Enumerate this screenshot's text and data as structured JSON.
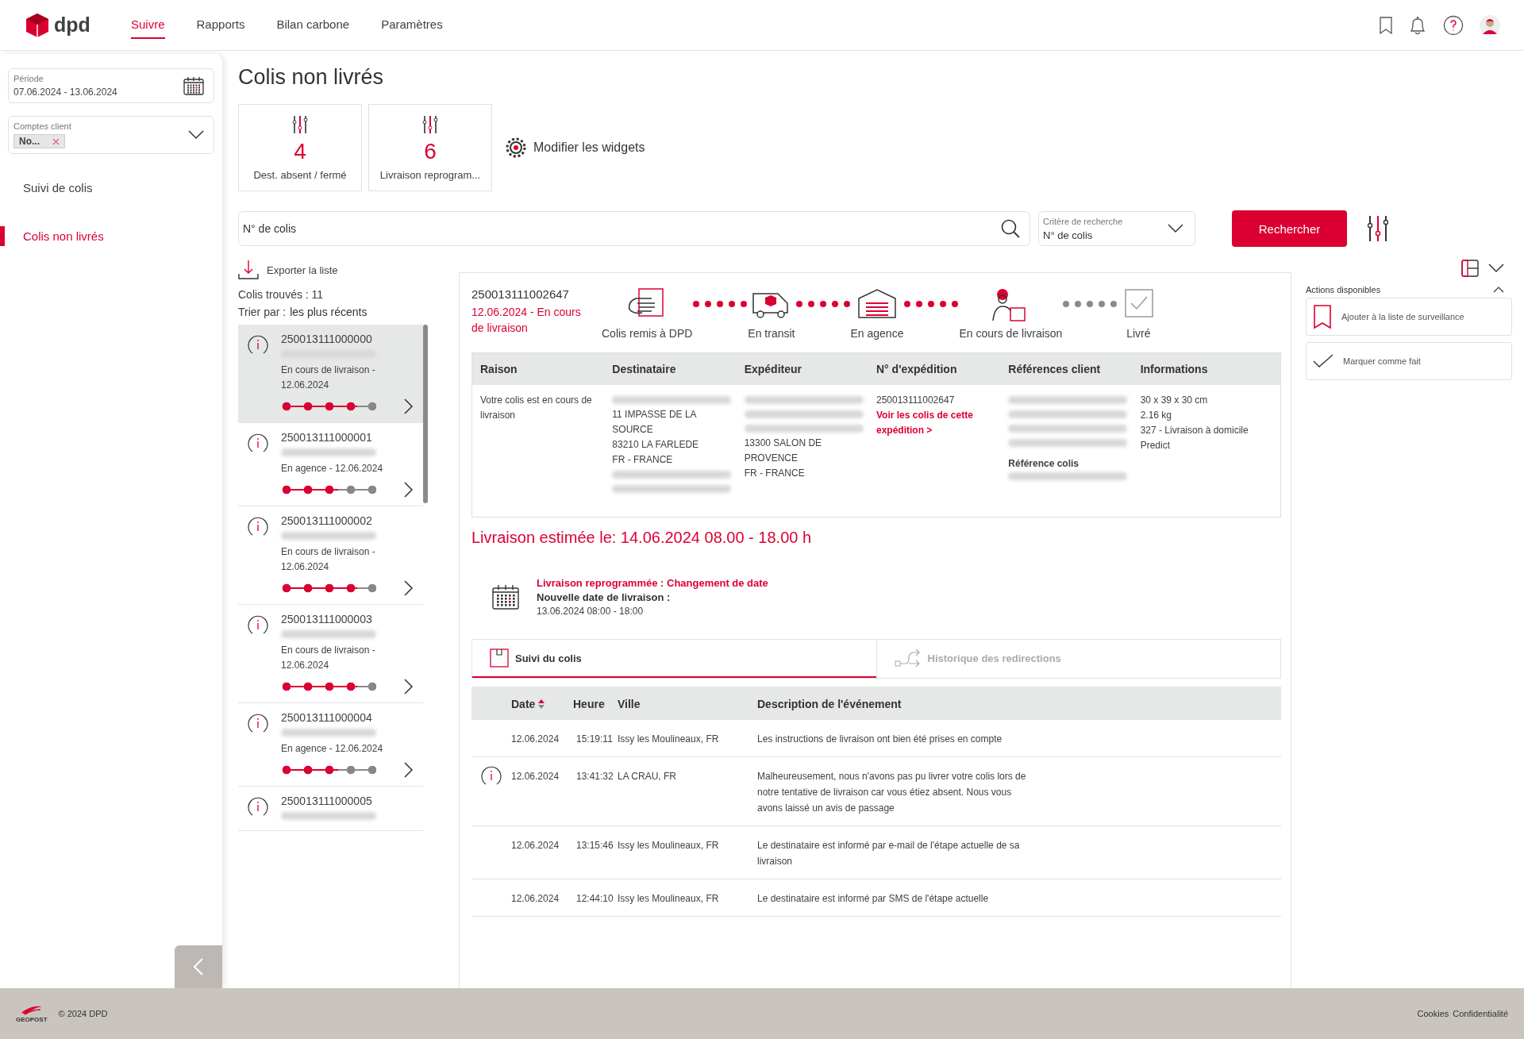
{
  "header": {
    "logo_text": "dpd",
    "nav": [
      {
        "label": "Suivre",
        "selected": true
      },
      {
        "label": "Rapports",
        "selected": false
      },
      {
        "label": "Bilan carbone",
        "selected": false
      },
      {
        "label": "Paramètres",
        "selected": false
      }
    ]
  },
  "sidebar": {
    "period": {
      "label": "Période",
      "value": "07.06.2024 - 13.06.2024"
    },
    "accounts": {
      "label": "Comptes client",
      "chip": "No..."
    },
    "items": [
      {
        "label": "Suivi de colis",
        "selected": false
      },
      {
        "label": "Colis non livrés",
        "selected": true
      }
    ]
  },
  "page_title": "Colis non livrés",
  "widgets": [
    {
      "count": "4",
      "label": "Dest. absent / fermé"
    },
    {
      "count": "6",
      "label": "Livraison reprogram..."
    }
  ],
  "modify_widgets": "Modifier les widgets",
  "search": {
    "placeholder": "N° de colis",
    "criterion_label": "Critère de recherche",
    "criterion_value": "N° de colis",
    "button": "Rechercher"
  },
  "export": "Exporter la liste",
  "found": "Colis trouvés : 11",
  "sort": {
    "label": "Trier par :",
    "value": "les plus récents"
  },
  "parcels": [
    {
      "number": "250013111000000",
      "status": "En cours de livraison - 12.06.2024",
      "level": 0.8,
      "selected": true
    },
    {
      "number": "250013111000001",
      "status": "En agence - 12.06.2024",
      "level": 0.6,
      "selected": false
    },
    {
      "number": "250013111000002",
      "status": "En cours de livraison - 12.06.2024",
      "level": 0.8,
      "selected": false
    },
    {
      "number": "250013111000003",
      "status": "En cours de livraison - 12.06.2024",
      "level": 0.8,
      "selected": false
    },
    {
      "number": "250013111000004",
      "status": "En agence - 12.06.2024",
      "level": 0.6,
      "selected": false
    },
    {
      "number": "250013111000005",
      "selected": false
    }
  ],
  "detail": {
    "number": "250013111002647",
    "status": "12.06.2024 - En cours de livraison",
    "stages": [
      {
        "label": "Colis remis à DPD",
        "kind": "hand",
        "reached": true
      },
      {
        "label": "En transit",
        "kind": "van",
        "reached": true
      },
      {
        "label": "En agence",
        "kind": "depot",
        "reached": true
      },
      {
        "label": "En cours de livraison",
        "kind": "courier",
        "reached": true
      },
      {
        "label": "Livré",
        "kind": "check",
        "reached": false
      }
    ],
    "table": {
      "columns": [
        "Raison",
        "Destinataire",
        "Expéditeur",
        "N° d'expédition",
        "Références client",
        "Informations"
      ],
      "cells": [
        [
          {
            "kind": "text",
            "text": "Votre colis est en cours de livraison"
          }
        ],
        [
          {
            "kind": "blur"
          },
          {
            "kind": "text",
            "text": "11 IMPASSE DE LA SOURCE"
          },
          {
            "kind": "text",
            "text": "83210 LA FARLEDE"
          },
          {
            "kind": "text",
            "text": "FR - FRANCE"
          },
          {
            "kind": "blur"
          },
          {
            "kind": "blur"
          }
        ],
        [
          {
            "kind": "blur"
          },
          {
            "kind": "blur"
          },
          {
            "kind": "blur"
          },
          {
            "kind": "text",
            "text": "13300 SALON DE PROVENCE"
          },
          {
            "kind": "text",
            "text": "FR - FRANCE"
          }
        ],
        [
          {
            "kind": "text",
            "text": "250013111002647"
          },
          {
            "kind": "link",
            "text": "Voir les colis de cette expédition >"
          }
        ],
        [
          {
            "kind": "blur"
          },
          {
            "kind": "blur"
          },
          {
            "kind": "blur"
          },
          {
            "kind": "blur"
          },
          {
            "kind": "heading",
            "text": "Référence colis"
          },
          {
            "kind": "blur"
          }
        ],
        [
          {
            "kind": "text",
            "text": "30 x 39 x 30 cm"
          },
          {
            "kind": "text",
            "text": "2.16 kg"
          },
          {
            "kind": "text",
            "text": "327 - Livraison à domicile"
          },
          {
            "kind": "text",
            "text": "Predict"
          }
        ]
      ]
    },
    "estimated": "Livraison estimée le: 14.06.2024 08.00 - 18.00 h",
    "reprogram": {
      "title": "Livraison reprogrammée : Changement de date",
      "subtitle": "Nouvelle date de livraison :",
      "value": "13.06.2024 08:00 - 18:00"
    },
    "tabs": [
      {
        "label": "Suivi du colis",
        "selected": true
      },
      {
        "label": "Historique des redirections",
        "selected": false
      }
    ],
    "events": {
      "columns": [
        {
          "label": "Date",
          "sorted": true
        },
        {
          "label": "Heure",
          "sorted": false
        },
        {
          "label": "Ville",
          "sorted": false
        },
        {
          "label": "Description de l'événement",
          "sorted": false
        }
      ],
      "rows": [
        {
          "alert": false,
          "date": "12.06.2024",
          "time": "15:19:11",
          "city": "Issy les Moulineaux, FR",
          "description": "Les instructions de livraison ont bien été prises en compte"
        },
        {
          "alert": true,
          "date": "12.06.2024",
          "time": "13:41:32",
          "city": "LA CRAU, FR",
          "description": "Malheureusement, nous n'avons pas pu livrer votre colis lors de notre tentative de livraison car vous étiez absent. Nous vous avons laissé un avis de passage"
        },
        {
          "alert": false,
          "date": "12.06.2024",
          "time": "13:15:46",
          "city": "Issy les Moulineaux, FR",
          "description": "Le destinataire est informé par e-mail de l'étape actuelle de sa livraison"
        },
        {
          "alert": false,
          "date": "12.06.2024",
          "time": "12:44:10",
          "city": "Issy les Moulineaux, FR",
          "description": "Le destinataire est informé par SMS de l'étape actuelle"
        }
      ]
    }
  },
  "actions": {
    "title": "Actions disponibles",
    "items": [
      {
        "kind": "watch",
        "label": "Ajouter à la liste de surveillance"
      },
      {
        "kind": "done",
        "label": "Marquer comme fait"
      }
    ]
  },
  "footer": {
    "brand": "GEOPOST",
    "copyright": "© 2024 DPD",
    "links": [
      "Cookies",
      "Confidentialité"
    ]
  }
}
